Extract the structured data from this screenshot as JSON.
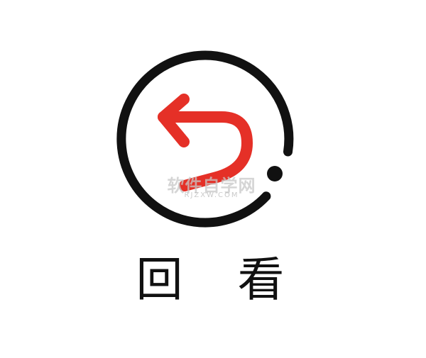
{
  "icon": {
    "name": "replay-icon",
    "ring_color": "#111111",
    "arrow_color": "#e53027"
  },
  "label": {
    "text": "回 看"
  },
  "watermark": {
    "primary": "软件自学网",
    "secondary": "RJZXW.COM"
  }
}
